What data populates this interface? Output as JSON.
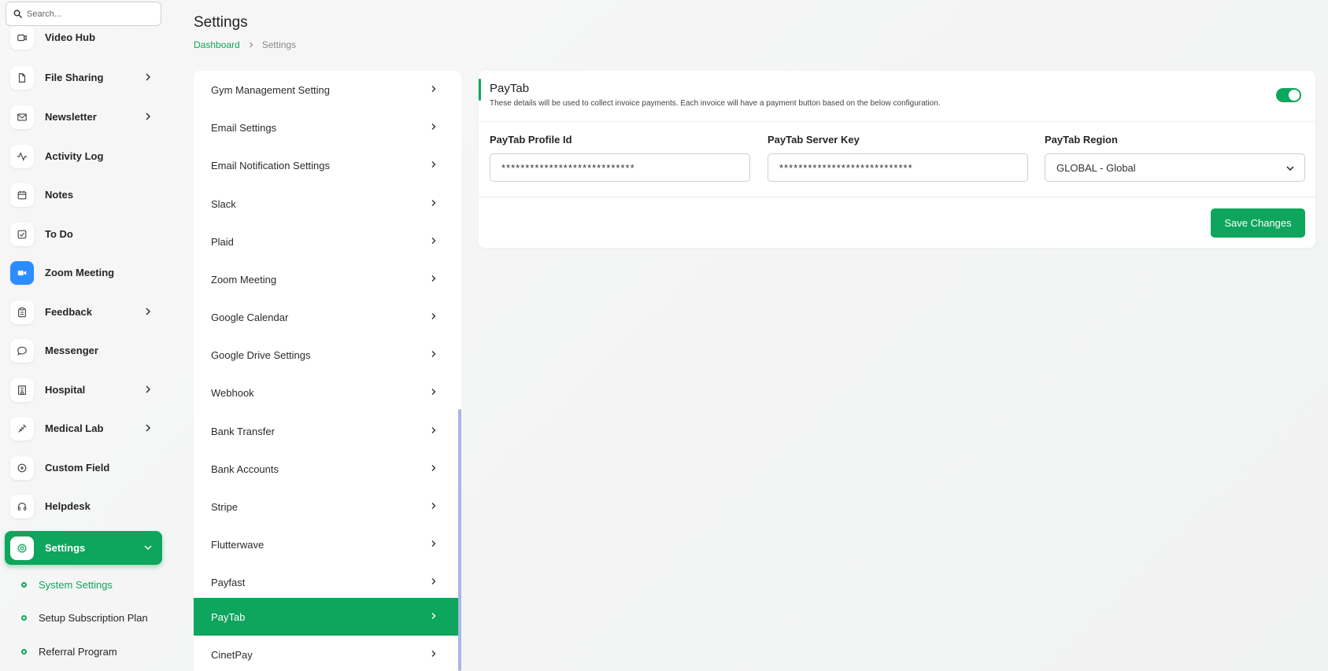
{
  "search": {
    "placeholder": "Search..."
  },
  "sidebar": {
    "items": [
      {
        "label": "Video Hub",
        "icon": "video-icon",
        "has_children": false
      },
      {
        "label": "File Sharing",
        "icon": "file-icon",
        "has_children": true
      },
      {
        "label": "Newsletter",
        "icon": "mail-icon",
        "has_children": true
      },
      {
        "label": "Activity Log",
        "icon": "activity-icon",
        "has_children": false
      },
      {
        "label": "Notes",
        "icon": "calendar-icon",
        "has_children": false
      },
      {
        "label": "To Do",
        "icon": "checkbox-icon",
        "has_children": false
      },
      {
        "label": "Zoom Meeting",
        "icon": "zoom-icon",
        "has_children": false
      },
      {
        "label": "Feedback",
        "icon": "clipboard-icon",
        "has_children": true
      },
      {
        "label": "Messenger",
        "icon": "chat-icon",
        "has_children": false
      },
      {
        "label": "Hospital",
        "icon": "building-icon",
        "has_children": true
      },
      {
        "label": "Medical Lab",
        "icon": "syringe-icon",
        "has_children": true
      },
      {
        "label": "Custom Field",
        "icon": "plus-circle-icon",
        "has_children": false
      },
      {
        "label": "Helpdesk",
        "icon": "headset-icon",
        "has_children": false
      },
      {
        "label": "Settings",
        "icon": "gear-icon",
        "has_children": true,
        "active": true
      }
    ],
    "sub_items": [
      {
        "label": "System Settings",
        "current": true
      },
      {
        "label": "Setup Subscription Plan",
        "current": false
      },
      {
        "label": "Referral Program",
        "current": false
      }
    ]
  },
  "header": {
    "title": "Settings",
    "breadcrumb": {
      "home": "Dashboard",
      "current": "Settings"
    }
  },
  "settings_menu": {
    "items": [
      "Gym Management Setting",
      "Email Settings",
      "Email Notification Settings",
      "Slack",
      "Plaid",
      "Zoom Meeting",
      "Google Calendar",
      "Google Drive Settings",
      "Webhook",
      "Bank Transfer",
      "Bank Accounts",
      "Stripe",
      "Flutterwave",
      "Payfast",
      "PayTab",
      "CinetPay"
    ],
    "active": "PayTab"
  },
  "paytab": {
    "title": "PayTab",
    "description": "These details will be used to collect invoice payments. Each invoice will have a payment button based on the below configuration.",
    "enabled": true,
    "profile_id_label": "PayTab Profile Id",
    "profile_id_value": "****************************",
    "server_key_label": "PayTab Server Key",
    "server_key_value": "****************************",
    "region_label": "PayTab Region",
    "region_value": "GLOBAL - Global",
    "save_label": "Save Changes"
  },
  "colors": {
    "accent": "#0ea55c",
    "scrollbar": "#a9b7e3",
    "zoom_brand": "#2d8cff"
  }
}
